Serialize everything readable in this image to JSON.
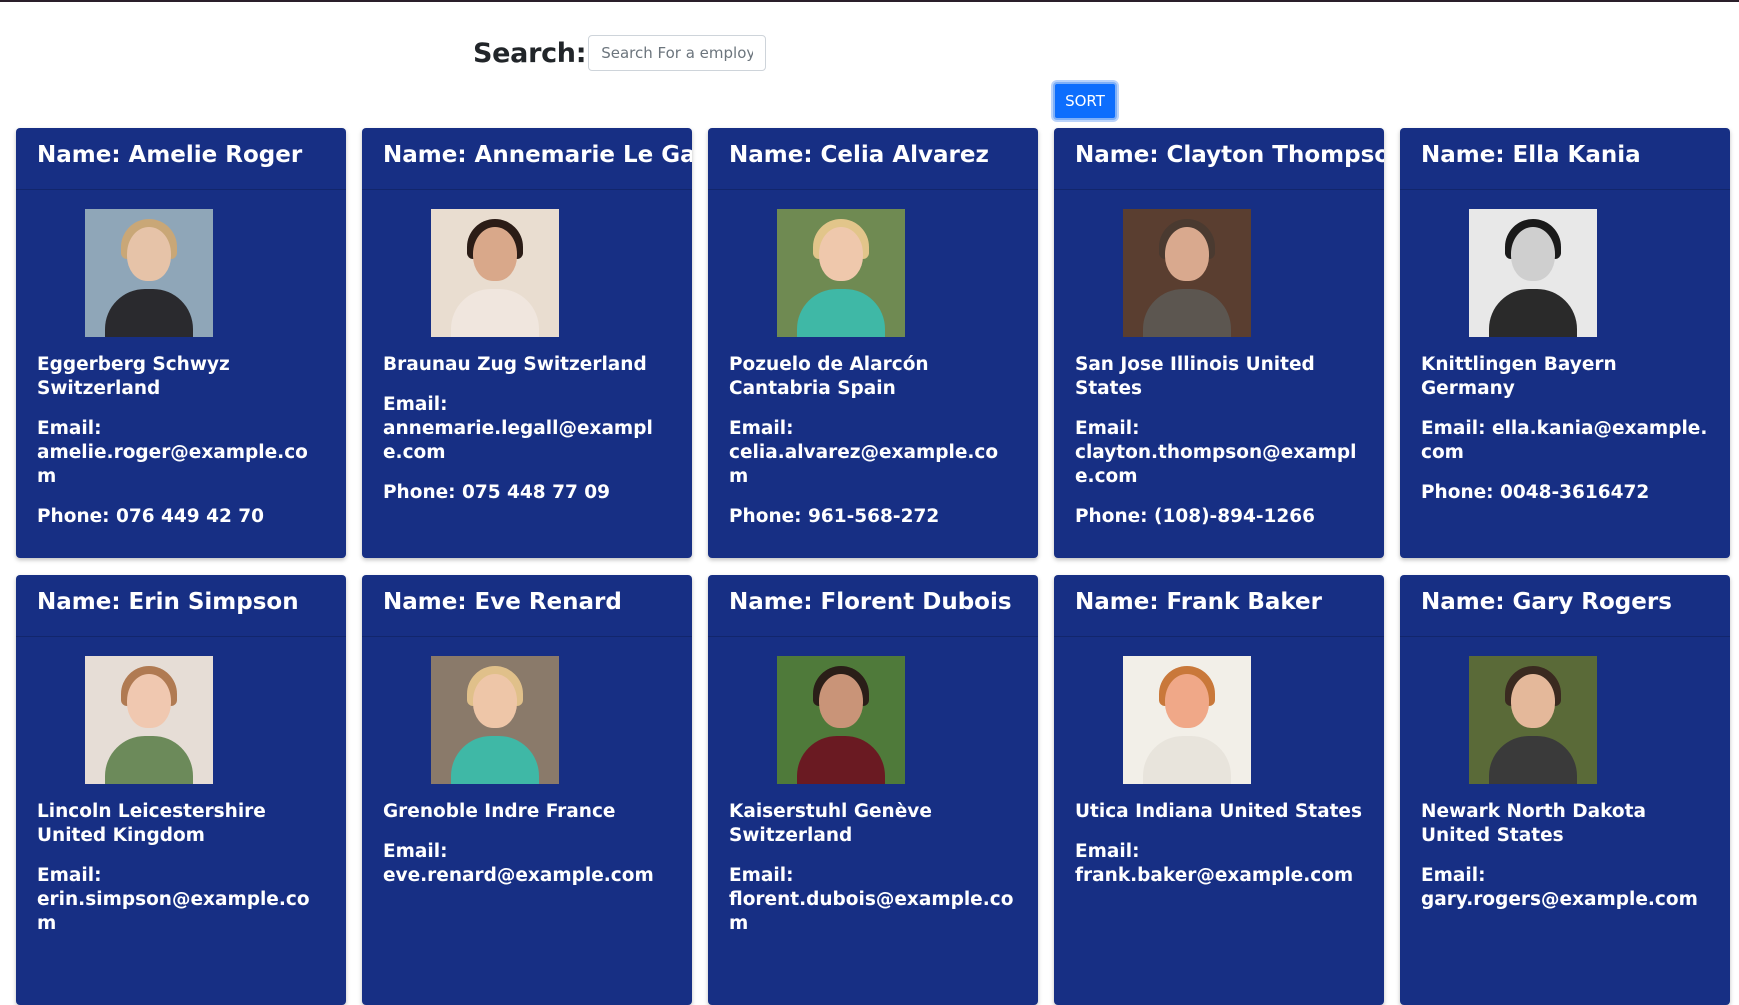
{
  "search": {
    "label": "Search:",
    "placeholder": "Search For a employee",
    "value": ""
  },
  "sort_button_label": "SORT",
  "colors": {
    "card_background": "#172f84",
    "sort_button": "#0d6efd"
  },
  "email_label": "Email:",
  "employees": [
    {
      "name_line": "Name: Amelie Roger",
      "location": "Eggerberg Schwyz Switzerland",
      "email_line": "Email: amelie.roger@example.com",
      "phone_line": "Phone: 076 449 42 70",
      "photo_colors": {
        "bg": "#8fa6b8",
        "skin": "#e6c3a8",
        "hair": "#c9a777",
        "shirt": "#2a2a2e"
      }
    },
    {
      "name_line": "Name: Annemarie Le Gall",
      "location": "Braunau Zug Switzerland",
      "email_line": "Email: annemarie.legall@example.com",
      "phone_line": "Phone: 075 448 77 09",
      "photo_colors": {
        "bg": "#e9ddd0",
        "skin": "#d9a88a",
        "hair": "#2b1c16",
        "shirt": "#f0e6de"
      }
    },
    {
      "name_line": "Name: Celia Alvarez",
      "location": "Pozuelo de Alarcón Cantabria Spain",
      "email_line": "Email: celia.alvarez@example.com",
      "phone_line": "Phone: 961-568-272",
      "photo_colors": {
        "bg": "#6f8a52",
        "skin": "#efc8ac",
        "hair": "#e2c58a",
        "shirt": "#3fb8a6"
      }
    },
    {
      "name_line": "Name: Clayton Thompson",
      "location": "San Jose Illinois United States",
      "email_line": "Email: clayton.thompson@example.com",
      "phone_line": "Phone: (108)-894-1266",
      "photo_colors": {
        "bg": "#5a3e30",
        "skin": "#d9a98e",
        "hair": "#4a3a30",
        "shirt": "#5c5650"
      }
    },
    {
      "name_line": "Name: Ella Kania",
      "location": "Knittlingen Bayern Germany",
      "email_line": "Email: ella.kania@example.com",
      "phone_line": "Phone: 0048-3616472",
      "photo_colors": {
        "bg": "#e8e8e8",
        "skin": "#cfcfcf",
        "hair": "#1a1a1a",
        "shirt": "#2a2a2a"
      }
    },
    {
      "name_line": "Name: Erin Simpson",
      "location": "Lincoln Leicestershire United Kingdom",
      "email_line": "Email: erin.simpson@example.com",
      "phone_line": "",
      "photo_colors": {
        "bg": "#e6ddd6",
        "skin": "#f0c8b0",
        "hair": "#b07a52",
        "shirt": "#6c8a5a"
      }
    },
    {
      "name_line": "Name: Eve Renard",
      "location": "Grenoble Indre France",
      "email_line": "Email: eve.renard@example.com",
      "phone_line": "",
      "photo_colors": {
        "bg": "#8a7a6a",
        "skin": "#eec6a8",
        "hair": "#e0c08a",
        "shirt": "#3fb8a6"
      }
    },
    {
      "name_line": "Name: Florent Dubois",
      "location": "Kaiserstuhl Genève Switzerland",
      "email_line": "Email: florent.dubois@example.com",
      "phone_line": "",
      "photo_colors": {
        "bg": "#4f7a3a",
        "skin": "#c99478",
        "hair": "#2a1e18",
        "shirt": "#6a1a22"
      }
    },
    {
      "name_line": "Name: Frank Baker",
      "location": "Utica Indiana United States",
      "email_line": "Email: frank.baker@example.com",
      "phone_line": "",
      "photo_colors": {
        "bg": "#f2efe8",
        "skin": "#f0a888",
        "hair": "#c9783a",
        "shirt": "#e8e4dc"
      }
    },
    {
      "name_line": "Name: Gary Rogers",
      "location": "Newark North Dakota United States",
      "email_line": "Email: gary.rogers@example.com",
      "phone_line": "",
      "photo_colors": {
        "bg": "#5a6a38",
        "skin": "#e4b89a",
        "hair": "#3a2a20",
        "shirt": "#3a3a3a"
      }
    }
  ]
}
